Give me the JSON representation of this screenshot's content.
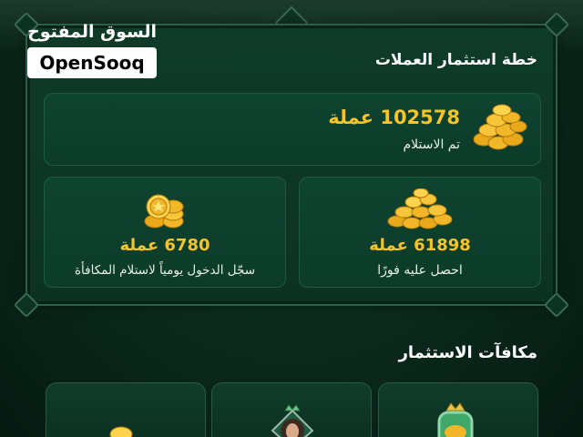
{
  "watermark": {
    "arabic": "السوق المفتوح",
    "latin": "OpenSooq"
  },
  "plan": {
    "title": "خطة استثمار العملات",
    "total": {
      "amount": "102578 عملة",
      "status": "تم الاستلام"
    },
    "instant": {
      "amount": "61898 عملة",
      "label": "احصل عليه فورًا"
    },
    "daily": {
      "amount": "6780 عملة",
      "label": "سجّل الدخول يومياً لاستلام المكافأة"
    }
  },
  "rewards": {
    "title": "مكافآت الاستثمار"
  },
  "colors": {
    "gold": "#f5c32c",
    "panel": "#0f3b29",
    "border": "#2d5e48"
  }
}
